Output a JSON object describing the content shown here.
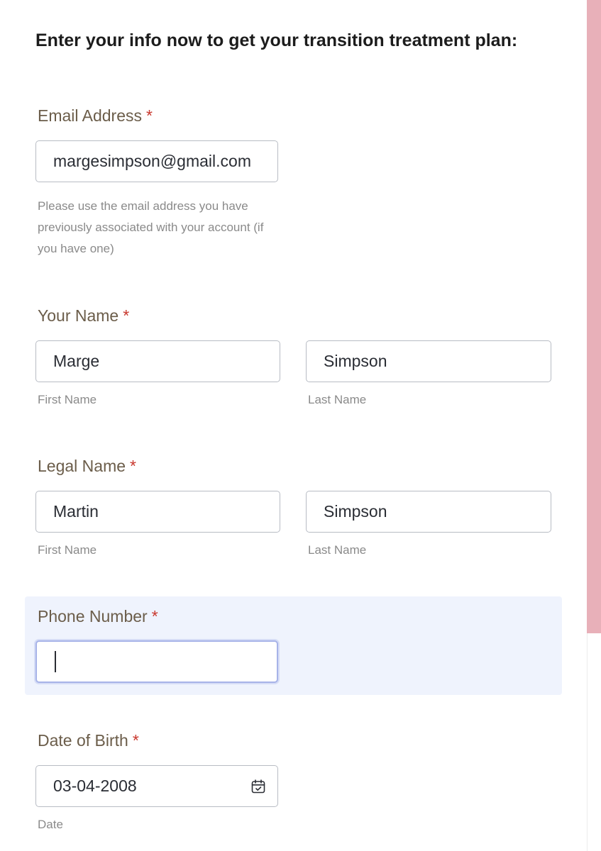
{
  "form": {
    "heading": "Enter your info now to get your transition treatment plan:",
    "required_marker": "*",
    "email": {
      "label": "Email Address",
      "value": "margesimpson@gmail.com",
      "help": "Please use the email address you have previously associated with your account (if you have one)"
    },
    "your_name": {
      "label": "Your Name",
      "first_value": "Marge",
      "first_sublabel": "First Name",
      "last_value": "Simpson",
      "last_sublabel": "Last Name"
    },
    "legal_name": {
      "label": "Legal Name",
      "first_value": "Martin",
      "first_sublabel": "First Name",
      "last_value": "Simpson",
      "last_sublabel": "Last Name"
    },
    "phone": {
      "label": "Phone Number",
      "value": ""
    },
    "dob": {
      "label": "Date of Birth",
      "value": "03-04-2008",
      "sublabel": "Date",
      "icon": "calendar-icon"
    }
  },
  "colors": {
    "label": "#6b5d4a",
    "required": "#c8372d",
    "focus_highlight": "#eff3fd",
    "scrollbar_thumb": "#e8b0b9"
  }
}
